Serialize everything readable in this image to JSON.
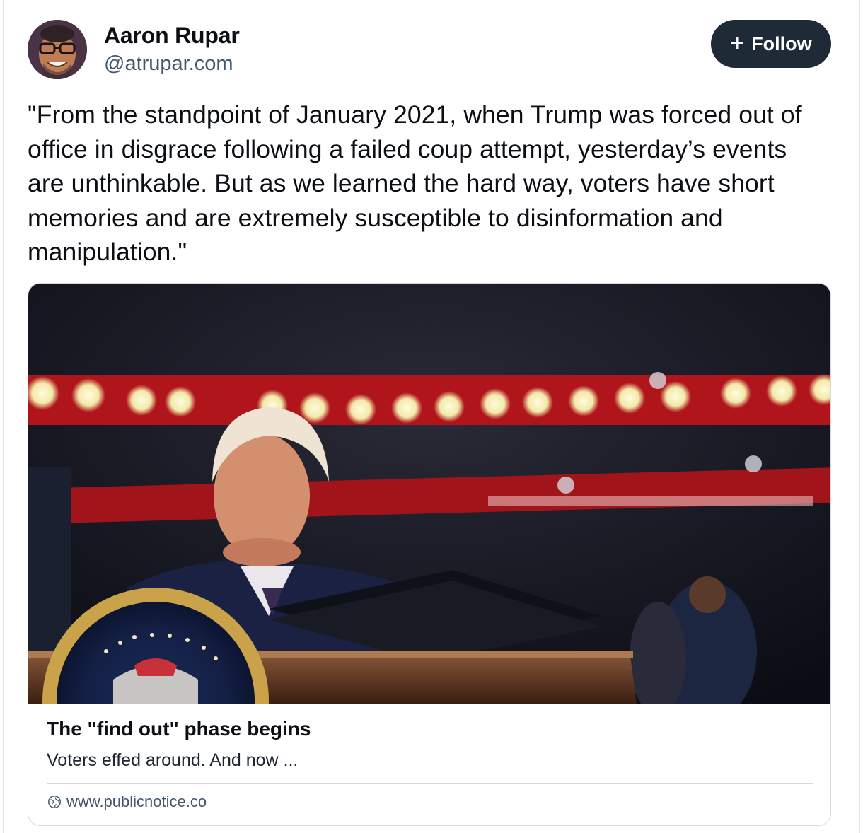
{
  "author": {
    "display_name": "Aaron Rupar",
    "handle": "@atrupar.com",
    "avatar_icon": "avatar-photo"
  },
  "actions": {
    "follow_label": "Follow",
    "follow_icon": "plus-icon"
  },
  "post": {
    "text": "\"From the standpoint of January 2021, when Trump was forced out of office in disgrace following a failed coup attempt, yesterday’s events are unthinkable. But as we learned the hard way, voters have short memories and are extremely susceptible to disinformation and manipulation.\""
  },
  "embed": {
    "image_icon": "article-photo",
    "title": "The \"find out\" phase begins",
    "description": "Voters effed around. And now ...",
    "domain": "www.publicnotice.co",
    "domain_icon": "globe-icon"
  },
  "colors": {
    "follow_button_bg": "#1f2a37",
    "handle_text": "#42576c",
    "border": "#d4d9df"
  }
}
